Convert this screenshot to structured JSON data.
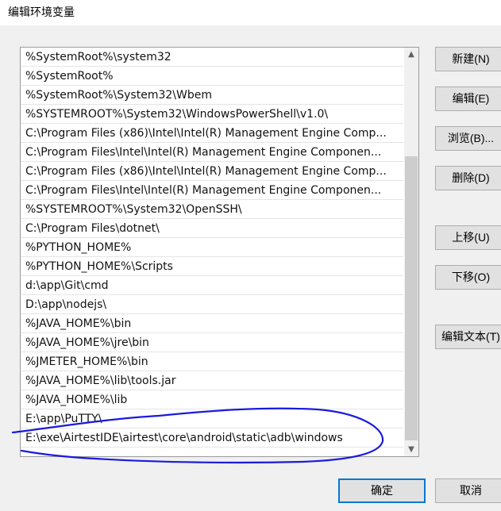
{
  "window": {
    "title": "编辑环境变量"
  },
  "path_list": {
    "items": [
      "%SystemRoot%\\system32",
      "%SystemRoot%",
      "%SystemRoot%\\System32\\Wbem",
      "%SYSTEMROOT%\\System32\\WindowsPowerShell\\v1.0\\",
      "C:\\Program Files (x86)\\Intel\\Intel(R) Management Engine Comp...",
      "C:\\Program Files\\Intel\\Intel(R) Management Engine Componen...",
      "C:\\Program Files (x86)\\Intel\\Intel(R) Management Engine Comp...",
      "C:\\Program Files\\Intel\\Intel(R) Management Engine Componen...",
      "%SYSTEMROOT%\\System32\\OpenSSH\\",
      "C:\\Program Files\\dotnet\\",
      "%PYTHON_HOME%",
      "%PYTHON_HOME%\\Scripts",
      "d:\\app\\Git\\cmd",
      "D:\\app\\nodejs\\",
      "%JAVA_HOME%\\bin",
      "%JAVA_HOME%\\jre\\bin",
      "%JMETER_HOME%\\bin",
      "%JAVA_HOME%\\lib\\tools.jar",
      "%JAVA_HOME%\\lib",
      "E:\\app\\PuTTY\\",
      "E:\\exe\\AirtestIDE\\airtest\\core\\android\\static\\adb\\windows"
    ]
  },
  "buttons": {
    "new": "新建(N)",
    "edit": "编辑(E)",
    "browse": "浏览(B)...",
    "delete": "删除(D)",
    "move_up": "上移(U)",
    "move_down": "下移(O)",
    "edit_text": "编辑文本(T)",
    "ok": "确定",
    "cancel": "取消"
  },
  "icons": {
    "scroll_up": "scroll-up-arrow-icon",
    "scroll_down": "scroll-down-arrow-icon"
  },
  "colors": {
    "annotation": "#1a1ae0",
    "primary_border": "#0078d7"
  }
}
